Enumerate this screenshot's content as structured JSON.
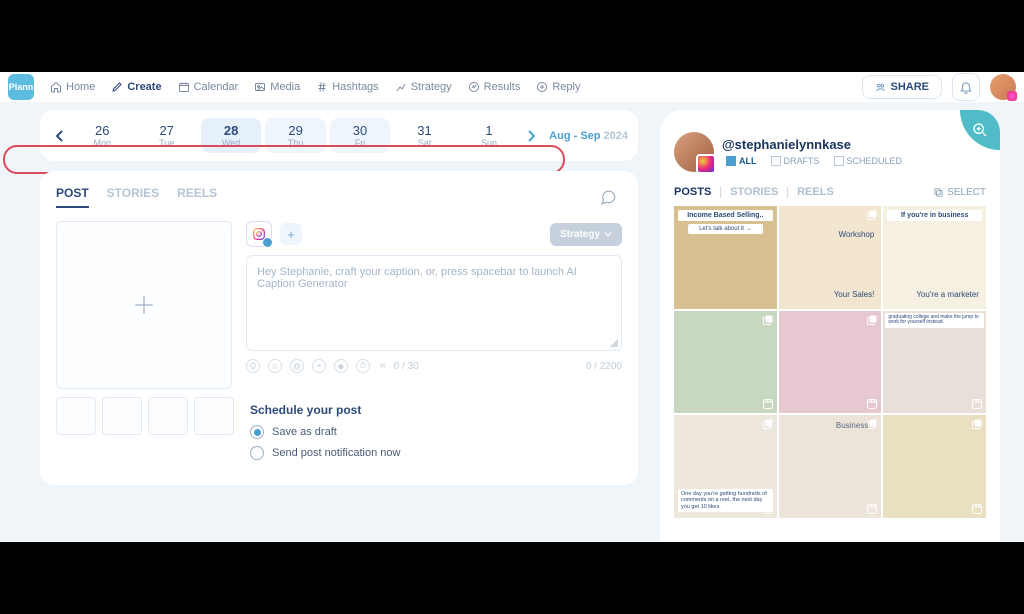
{
  "brand": "Plann",
  "nav": {
    "items": [
      {
        "icon": "home",
        "label": "Home"
      },
      {
        "icon": "pencil",
        "label": "Create",
        "active": true
      },
      {
        "icon": "calendar",
        "label": "Calendar"
      },
      {
        "icon": "media",
        "label": "Media"
      },
      {
        "icon": "hashtag",
        "label": "Hashtags"
      },
      {
        "icon": "chart",
        "label": "Strategy"
      },
      {
        "icon": "results",
        "label": "Results"
      },
      {
        "icon": "reply",
        "label": "Reply"
      }
    ],
    "share": "SHARE"
  },
  "date_strip": {
    "days": [
      {
        "num": "26",
        "dow": "Mon"
      },
      {
        "num": "27",
        "dow": "Tue"
      },
      {
        "num": "28",
        "dow": "Wed",
        "selected": true
      },
      {
        "num": "29",
        "dow": "Thu",
        "soft": true
      },
      {
        "num": "30",
        "dow": "Fri",
        "soft": true
      },
      {
        "num": "31",
        "dow": "Sat"
      },
      {
        "num": "1",
        "dow": "Sun"
      }
    ],
    "month": "Aug - Sep",
    "year": "2024"
  },
  "composer": {
    "tabs": [
      {
        "label": "POST",
        "active": true
      },
      {
        "label": "STORIES"
      },
      {
        "label": "REELS"
      }
    ],
    "strategy_btn": "Strategy",
    "placeholder": "Hey Stephanie, craft your caption, or, press spacebar to launch AI Caption Generator",
    "hashtag_counter": "0 / 30",
    "char_counter": "0 / 2200"
  },
  "schedule": {
    "title": "Schedule your post",
    "options": [
      {
        "label": "Save as draft",
        "checked": true
      },
      {
        "label": "Send post notification now",
        "checked": false
      }
    ]
  },
  "preview": {
    "handle": "@stephanielynnkase",
    "filters": [
      {
        "label": "ALL",
        "active": true
      },
      {
        "label": "DRAFTS"
      },
      {
        "label": "SCHEDULED"
      }
    ],
    "feed_tabs": [
      {
        "label": "POSTS",
        "active": true
      },
      {
        "label": "STORIES"
      },
      {
        "label": "REELS"
      }
    ],
    "select": "SELECT",
    "cells": [
      {
        "bg": "#d8c090",
        "text_top": "Income Based Selling..",
        "text_sub": "Let's talk about it →"
      },
      {
        "bg": "#f2e6d0",
        "text_mid": "Workshop",
        "text_low": "Your Sales!"
      },
      {
        "bg": "#f6f0e2",
        "text_top": "If you're in business",
        "text_low": "You're a marketer"
      },
      {
        "bg": "#c8d8c0"
      },
      {
        "bg": "#e8c8d0"
      },
      {
        "bg": "#e8e0d8",
        "text_tiny": "graduating college and make the jump to work for yourself instead."
      },
      {
        "bg": "#eee8dc",
        "text_cap": "One day you're getting hundreds of comments on a reel, the next day you get 10 likes."
      },
      {
        "bg": "#ece4d8",
        "text_top2": "Business"
      },
      {
        "bg": "#e8e0c0"
      }
    ]
  }
}
